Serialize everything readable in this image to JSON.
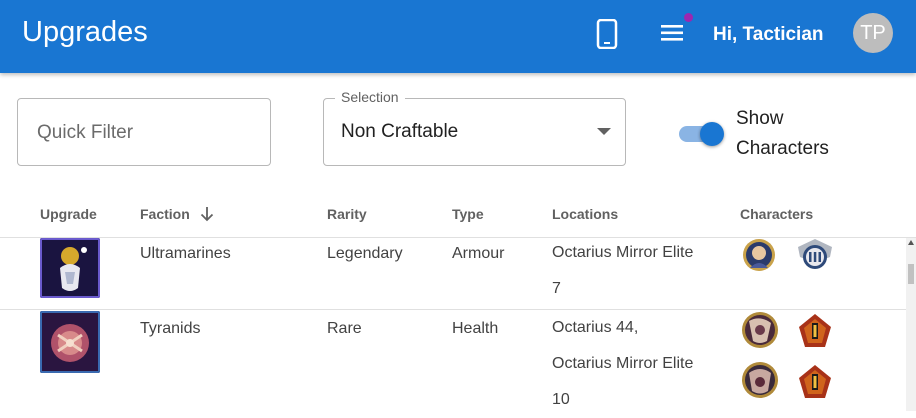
{
  "app": {
    "title": "Upgrades",
    "greeting": "Hi, Tactician",
    "avatar_initials": "TP"
  },
  "icons": {
    "device": "smartphone-icon",
    "menu": "hamburger-menu-icon",
    "sort": "arrow-down-icon",
    "dropdown": "triangle-down-icon"
  },
  "filters": {
    "quick_filter_placeholder": "Quick Filter",
    "quick_filter_value": "",
    "selection_label": "Selection",
    "selection_value": "Non Craftable",
    "show_characters_label": "Show Characters",
    "show_characters_on": true
  },
  "table": {
    "columns": [
      "Upgrade",
      "Faction",
      "Rarity",
      "Type",
      "Locations",
      "Characters"
    ],
    "sorted_column": "Faction",
    "sort_direction": "descending",
    "rows": [
      {
        "faction": "Ultramarines",
        "rarity": "Legendary",
        "type": "Armour",
        "locations": [
          "Octarius Mirror Elite",
          "7"
        ],
        "characters": [
          "character-portrait-icon",
          "ultramarines-rank-badge-icon"
        ]
      },
      {
        "faction": "Tyranids",
        "rarity": "Rare",
        "type": "Health",
        "locations": [
          "Octarius 44,",
          "Octarius Mirror Elite",
          "10"
        ],
        "characters": [
          "character-portrait-icon",
          "rank-badge-icon",
          "character-portrait-icon",
          "rank-badge-icon"
        ]
      }
    ]
  },
  "colors": {
    "appbar": "#1976d2",
    "notification_dot": "#9c27b0",
    "toggle_track": "#8ab4e4"
  }
}
